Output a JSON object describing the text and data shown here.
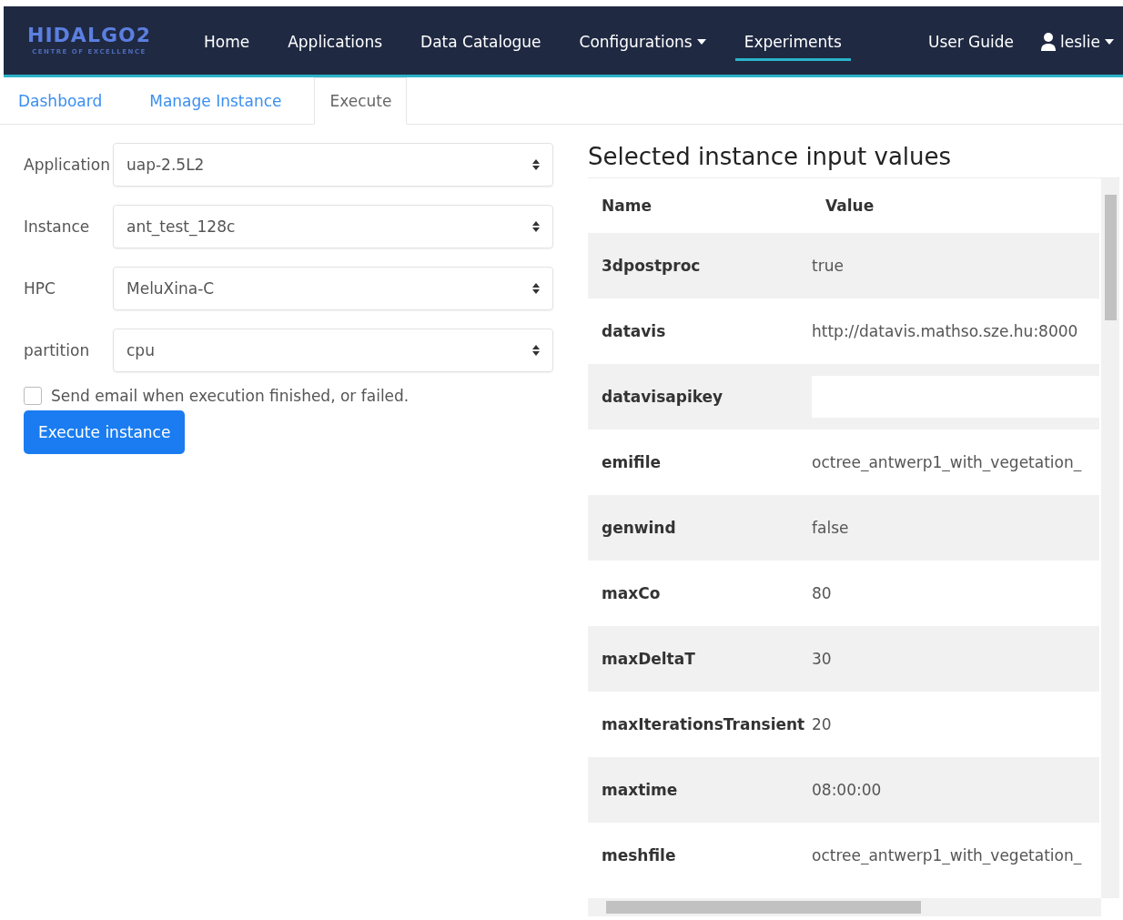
{
  "navbar": {
    "logo": {
      "title": "HIDALGO2",
      "subtitle": "CENTRE OF EXCELLENCE"
    },
    "links": [
      {
        "label": "Home",
        "selected": false,
        "dropdown": false
      },
      {
        "label": "Applications",
        "selected": false,
        "dropdown": false
      },
      {
        "label": "Data Catalogue",
        "selected": false,
        "dropdown": false
      },
      {
        "label": "Configurations",
        "selected": false,
        "dropdown": true
      },
      {
        "label": "Experiments",
        "selected": true,
        "dropdown": false
      }
    ],
    "right": [
      {
        "label": "User Guide",
        "kind": "link"
      },
      {
        "label": "leslie",
        "kind": "user"
      }
    ]
  },
  "tabs": [
    {
      "label": "Dashboard",
      "selected": false
    },
    {
      "label": "Manage Instance",
      "selected": false
    },
    {
      "label": "Execute",
      "selected": true
    }
  ],
  "form": {
    "fields": [
      {
        "label": "Application",
        "value": "uap-2.5L2"
      },
      {
        "label": "Instance",
        "value": "ant_test_128c"
      },
      {
        "label": "HPC",
        "value": "MeluXina-C"
      },
      {
        "label": "partition",
        "value": "cpu"
      }
    ],
    "email_checkbox": {
      "label": "Send email when execution finished, or failed.",
      "checked": false
    },
    "button": "Execute instance"
  },
  "table": {
    "title": "Selected instance input values",
    "columns": [
      "Name",
      "Value"
    ],
    "rows": [
      {
        "name": "3dpostproc",
        "value": "true",
        "kind": "text"
      },
      {
        "name": "datavis",
        "value": "http://datavis.mathso.sze.hu:8000",
        "kind": "text"
      },
      {
        "name": "datavisapikey",
        "kind": "input"
      },
      {
        "name": "emifile",
        "value": "octree_antwerp1_with_vegetation_",
        "kind": "text"
      },
      {
        "name": "genwind",
        "value": "false",
        "kind": "text"
      },
      {
        "name": "maxCo",
        "value": "80",
        "kind": "text"
      },
      {
        "name": "maxDeltaT",
        "value": "30",
        "kind": "text"
      },
      {
        "name": "maxIterationsTransient",
        "value": "20",
        "kind": "text"
      },
      {
        "name": "maxtime",
        "value": "08:00:00",
        "kind": "text"
      },
      {
        "name": "meshfile",
        "value": "octree_antwerp1_with_vegetation_",
        "kind": "text"
      }
    ]
  }
}
